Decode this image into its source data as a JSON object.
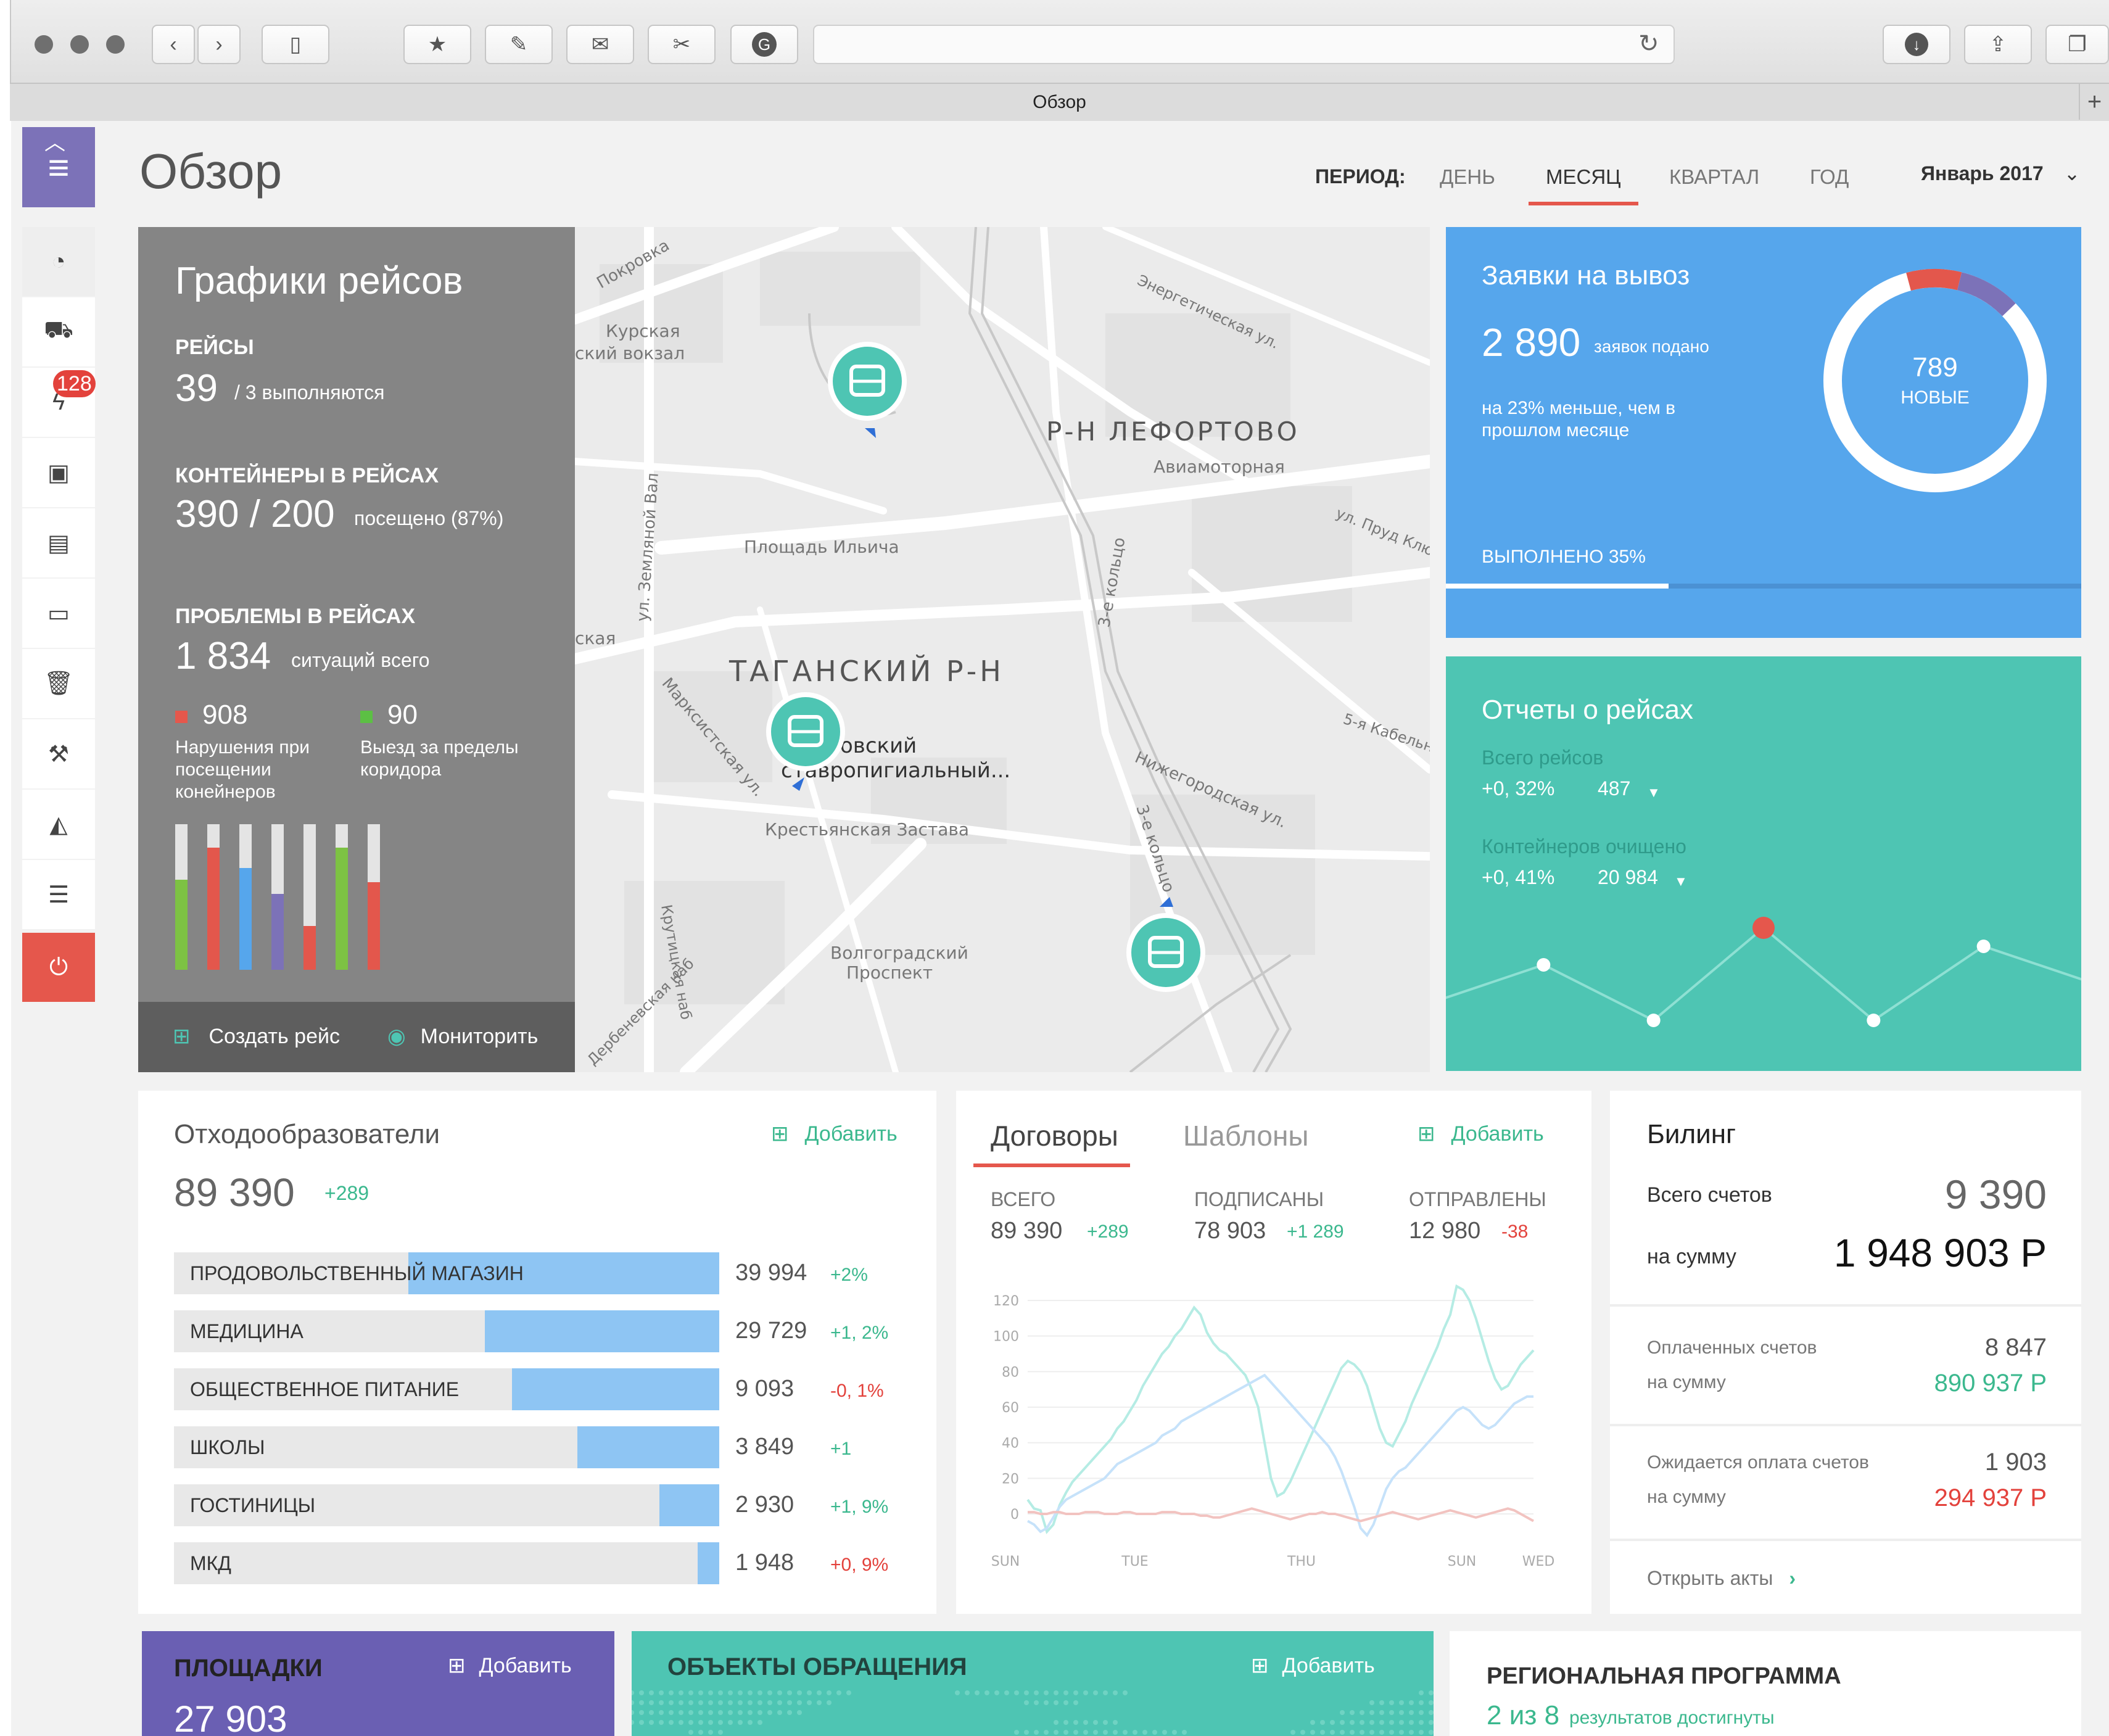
{
  "window": {
    "tab_title": "Обзор"
  },
  "page": {
    "title": "Обзор"
  },
  "period": {
    "label": "ПЕРИОД:",
    "tabs": [
      "ДЕНЬ",
      "МЕСЯЦ",
      "КВАРТАЛ",
      "ГОД"
    ],
    "active": "МЕСЯЦ",
    "month": "Январь 2017"
  },
  "sidebar": {
    "badge": "128"
  },
  "flights": {
    "title": "Графики рейсов",
    "trips_label": "РЕЙСЫ",
    "trips_value": "39",
    "trips_sub": "/ 3 выполняются",
    "containers_label": "КОНТЕЙНЕРЫ В РЕЙСАХ",
    "containers_value": "390 / 200",
    "containers_sub": "посещено (87%)",
    "problems_label": "ПРОБЛЕМЫ В РЕЙСАХ",
    "problems_value": "1 834",
    "problems_sub": "ситуаций всего",
    "violations_value": "908",
    "violations_text": [
      "Нарушения при",
      "посещении",
      "конейнеров"
    ],
    "corridor_value": "90",
    "corridor_text": [
      "Выезд за пределы",
      "коридора"
    ],
    "bars": [
      {
        "level": 0.62,
        "color": "#7dc243"
      },
      {
        "level": 0.84,
        "color": "#e3574c"
      },
      {
        "level": 0.7,
        "color": "#56a6ec"
      },
      {
        "level": 0.52,
        "color": "#7c72b8"
      },
      {
        "level": 0.3,
        "color": "#e3574c"
      },
      {
        "level": 0.84,
        "color": "#7dc243"
      },
      {
        "level": 0.6,
        "color": "#e3574c"
      }
    ],
    "create_label": "Создать рейс",
    "monitor_label": "Мониторить"
  },
  "map": {
    "labels": [
      "Покровка",
      "Курская",
      "ский вокзал",
      "Энергетическая ул.",
      "Р-Н ЛЕФОРТОВО",
      "Авиамоторная",
      "ул. Пруд Ключ",
      "Площадь Ильича",
      "ул. Земляной Вал",
      "3-е кольцо",
      "ская",
      "ТАГАНСКИЙ Р-Н",
      "Марксистская ул.",
      "овский",
      "ставропигиальный...",
      "5-я Кабельн",
      "Нижегородская ул.",
      "Крестьянская Застава",
      "3-е кольцо",
      "Волгоградский",
      "Проспект",
      "Крутицкая наб",
      "Дербеневская наб"
    ]
  },
  "requests": {
    "title": "Заявки на вывоз",
    "count": "2 890",
    "count_sub": "заявок подано",
    "note": [
      "на 23% меньше, чем в",
      "прошлом месяце"
    ],
    "new_count": "789",
    "new_label": "НОВЫЕ",
    "done_label": "ВЫПОЛНЕНО 35%",
    "done_fraction": 0.35,
    "donut_segments": [
      {
        "fraction": 0.08,
        "color": "#e3574c"
      },
      {
        "fraction": 0.09,
        "color": "#7c72b8"
      }
    ]
  },
  "reports": {
    "title": "Отчеты о рейсах",
    "total_label": "Всего рейсов",
    "total_change": "+0, 32%",
    "total_value": "487",
    "cleaned_label": "Контейнеров очищено",
    "cleaned_change": "+0, 41%",
    "cleaned_value": "20 984",
    "points": [
      {
        "value": 3,
        "highlight": false
      },
      {
        "value": 5,
        "highlight": false
      },
      {
        "value": 2,
        "highlight": false
      },
      {
        "value": 7,
        "highlight": true
      },
      {
        "value": 2,
        "highlight": false
      },
      {
        "value": 6,
        "highlight": false
      },
      {
        "value": 4,
        "highlight": false
      }
    ]
  },
  "generators": {
    "title": "Отходообразователи",
    "add_label": "Добавить",
    "total": "89 390",
    "total_change": "+289",
    "rows": [
      {
        "name": "ПРОДОВОЛЬСТВЕННЫЙ МАГАЗИН",
        "value": "39 994",
        "change": "+2%",
        "positive": true,
        "level": 0.57
      },
      {
        "name": "МЕДИЦИНА",
        "value": "29 729",
        "change": "+1, 2%",
        "positive": true,
        "level": 0.43
      },
      {
        "name": "ОБЩЕСТВЕННОЕ ПИТАНИЕ",
        "value": "9 093",
        "change": "-0, 1%",
        "positive": false,
        "level": 0.38
      },
      {
        "name": "ШКОЛЫ",
        "value": "3 849",
        "change": "+1",
        "positive": true,
        "level": 0.26
      },
      {
        "name": "ГОСТИНИЦЫ",
        "value": "2 930",
        "change": "+1, 9%",
        "positive": true,
        "level": 0.11
      },
      {
        "name": "МКД",
        "value": "1 948",
        "change": "+0, 9%",
        "positive": false,
        "level": 0.04
      }
    ]
  },
  "contracts": {
    "tabs": [
      "Договоры",
      "Шаблоны"
    ],
    "add_label": "Добавить",
    "stats": [
      {
        "label": "ВСЕГО",
        "value": "89 390",
        "change": "+289",
        "positive": true
      },
      {
        "label": "ПОДПИСАНЫ",
        "value": "78 903",
        "change": "+1 289",
        "positive": true
      },
      {
        "label": "ОТПРАВЛЕНЫ",
        "value": "12 980",
        "change": "-38",
        "positive": false
      }
    ]
  },
  "chart_data": {
    "type": "line",
    "title": "",
    "xlabel": "",
    "ylabel": "",
    "ylim": [
      0,
      120
    ],
    "yticks": [
      "0",
      "20",
      "40",
      "60",
      "80",
      "100",
      "120"
    ],
    "xtick_labels": [
      "SUN",
      "TUE",
      "THU",
      "SUN",
      "WED"
    ],
    "grid": true,
    "series": [
      {
        "color": "#b5ece4",
        "values": [
          8,
          3,
          2,
          -10,
          -6,
          5,
          12,
          18,
          22,
          26,
          30,
          34,
          38,
          42,
          48,
          52,
          58,
          64,
          72,
          78,
          84,
          90,
          94,
          100,
          104,
          110,
          116,
          112,
          102,
          96,
          92,
          90,
          86,
          82,
          78,
          70,
          60,
          40,
          20,
          10,
          12,
          18,
          26,
          34,
          42,
          50,
          58,
          66,
          74,
          82,
          86,
          84,
          80,
          72,
          60,
          48,
          40,
          38,
          45,
          52,
          62,
          70,
          78,
          86,
          94,
          104,
          112,
          128,
          126,
          120,
          110,
          98,
          86,
          76,
          70,
          72,
          78,
          84,
          88,
          92
        ]
      },
      {
        "color": "#c6e2fa",
        "values": [
          -4,
          -6,
          -10,
          -8,
          -2,
          4,
          8,
          10,
          12,
          14,
          16,
          18,
          20,
          24,
          28,
          30,
          32,
          34,
          36,
          38,
          40,
          44,
          46,
          48,
          52,
          54,
          56,
          58,
          60,
          62,
          64,
          66,
          68,
          70,
          72,
          74,
          76,
          78,
          74,
          70,
          66,
          62,
          58,
          54,
          50,
          46,
          42,
          38,
          32,
          24,
          14,
          4,
          -8,
          -12,
          -6,
          4,
          14,
          20,
          24,
          26,
          30,
          34,
          38,
          42,
          46,
          50,
          54,
          58,
          60,
          58,
          54,
          50,
          48,
          50,
          54,
          58,
          62,
          64,
          66,
          66
        ]
      },
      {
        "color": "#f2c3c0",
        "values": [
          1,
          1,
          0,
          0,
          1,
          1,
          0,
          0,
          0,
          1,
          1,
          1,
          0,
          0,
          0,
          1,
          1,
          0,
          0,
          0,
          0,
          1,
          1,
          1,
          0,
          0,
          0,
          -1,
          -1,
          -2,
          -2,
          -1,
          0,
          1,
          2,
          3,
          2,
          1,
          0,
          -1,
          -2,
          -3,
          -2,
          -1,
          0,
          0,
          1,
          0,
          0,
          -1,
          -2,
          -3,
          -4,
          -3,
          -2,
          -1,
          0,
          1,
          0,
          -1,
          -2,
          -3,
          -2,
          -1,
          0,
          1,
          2,
          1,
          0,
          -1,
          -2,
          -1,
          0,
          1,
          2,
          3,
          2,
          0,
          -2,
          -4
        ]
      }
    ]
  },
  "billing": {
    "title": "Билинг",
    "total_label": "Всего счетов",
    "total_value": "9 390",
    "sum_label": "на сумму",
    "sum_value": "1 948 903 Р",
    "paid_label": "Оплаченных счетов",
    "paid_value": "8 847",
    "paid_sum_label": "на сумму",
    "paid_sum_value": "890 937 Р",
    "pending_label": "Ожидается оплата счетов",
    "pending_value": "1 903",
    "pending_sum_label": "на сумму",
    "pending_sum_value": "294 937 Р",
    "acts_label": "Открыть акты"
  },
  "sites": {
    "title": "ПЛОЩАДКИ",
    "add_label": "Добавить",
    "value": "27 903"
  },
  "objects": {
    "title": "ОБЪЕКТЫ ОБРАЩЕНИЯ",
    "add_label": "Добавить"
  },
  "regional": {
    "title": "РЕГИОНАЛЬНАЯ ПРОГРАММА",
    "value": "2 из 8",
    "sub": "результатов достигнуты"
  },
  "colors": {
    "accent_red": "#e5574c",
    "blue": "#56a6ec",
    "teal": "#4ec5b3",
    "purple": "#6a5fb3",
    "positive": "#3bb88e",
    "negative": "#e3423c"
  }
}
